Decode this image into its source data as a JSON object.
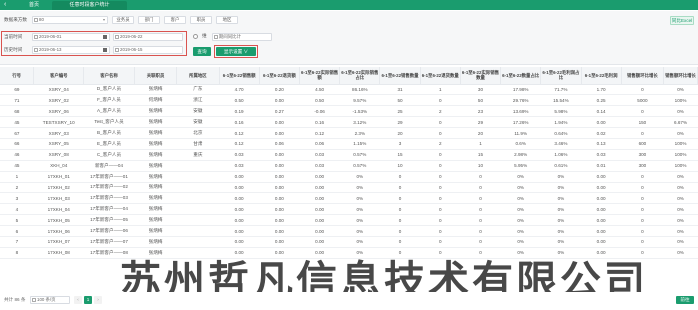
{
  "topbar": {
    "back_icon": "‹",
    "tab_home": "首页",
    "tab_current": "任意时段客户统计"
  },
  "filters": {
    "summary_label": "数据来方数",
    "summary_value": "80",
    "dimension_chips": [
      "业务员",
      "部门",
      "客户",
      "职员",
      "地区"
    ],
    "select_extra_label": "",
    "current_time_label": "当前时间",
    "current_from": "2019-06-01",
    "current_to": "2019-06-22",
    "history_time_label": "历史时间",
    "history_from": "2019-06-13",
    "history_to": "2019-06-15",
    "compare_label": "维",
    "compare_value": "期间同比计",
    "query_button": "查询",
    "display_setting_button": "显示设置 ∨",
    "top_right_button": "同比Excel"
  },
  "table": {
    "headers": [
      "行号",
      "客户编号",
      "客户名称",
      "关联职员",
      "所属地区",
      "6-1至6-22销售额",
      "6-1至6-22退货额",
      "6-1至6-22实际销售额",
      "6-1至6-22实际销售占比",
      "6-1至6-22销售数量",
      "6-1至6-22退货数量",
      "6-1至6-22实际销售数量",
      "6-1至6-22数量占比",
      "6-1至6-22毛利润占比",
      "6-1至6-22毛利润",
      "销售额环比增长",
      "销售额环比增长"
    ],
    "rows": [
      [
        "69",
        "XSRY_04",
        "D_客户人员",
        "张炳梅",
        "广东",
        "4.70",
        "0.20",
        "4.50",
        "86.16%",
        "31",
        "1",
        "30",
        "17.98%",
        "71.7%",
        "1.70",
        "0",
        "0%"
      ],
      [
        "71",
        "XSRY_02",
        "F_客户人员",
        "何炳梅",
        "浙江",
        "0.50",
        "0.00",
        "0.50",
        "9.57%",
        "50",
        "0",
        "50",
        "29.76%",
        "15.54%",
        "0.25",
        "5000",
        "100%"
      ],
      [
        "68",
        "XSRY_06",
        "A_客户人员",
        "张炳梅",
        "安徽",
        "0.19",
        "0.27",
        "-0.06",
        "-1.53%",
        "25",
        "2",
        "23",
        "13.69%",
        "5.98%",
        "0.14",
        "0",
        "0%"
      ],
      [
        "45",
        "TESTXSRY_10",
        "Test_客户人员",
        "张炳梅",
        "安徽",
        "0.16",
        "0.00",
        "0.16",
        "3.12%",
        "29",
        "0",
        "29",
        "17.26%",
        "1.94%",
        "0.00",
        "150",
        "6.67%"
      ],
      [
        "67",
        "XSRY_03",
        "B_客户人员",
        "张炳梅",
        "北京",
        "0.12",
        "0.00",
        "0.12",
        "2.3%",
        "20",
        "0",
        "20",
        "11.9%",
        "0.64%",
        "0.02",
        "0",
        "0%"
      ],
      [
        "66",
        "XSRY_05",
        "E_客户人员",
        "张炳梅",
        "甘肃",
        "0.12",
        "0.06",
        "0.06",
        "1.15%",
        "3",
        "2",
        "1",
        "0.6%",
        "3.46%",
        "0.13",
        "600",
        "100%"
      ],
      [
        "46",
        "XSRY_08",
        "C_客户人员",
        "张炳梅",
        "重庆",
        "0.03",
        "0.00",
        "0.03",
        "0.57%",
        "15",
        "0",
        "15",
        "2.98%",
        "1.06%",
        "0.03",
        "300",
        "100%"
      ],
      [
        "45",
        "XKH_04",
        "新客户——04",
        "张炳梅",
        "",
        "0.03",
        "0.00",
        "0.03",
        "0.57%",
        "10",
        "0",
        "10",
        "5.95%",
        "0.61%",
        "0.01",
        "300",
        "100%"
      ],
      [
        "1",
        "17XKH_01",
        "17年新客户——01",
        "张炳梅",
        "",
        "0.00",
        "0.00",
        "0.00",
        "0%",
        "0",
        "0",
        "0",
        "0%",
        "0%",
        "0.00",
        "0",
        "0%"
      ],
      [
        "2",
        "17XKH_02",
        "17年新客户——02",
        "张炳梅",
        "",
        "0.00",
        "0.00",
        "0.00",
        "0%",
        "0",
        "0",
        "0",
        "0%",
        "0%",
        "0.00",
        "0",
        "0%"
      ],
      [
        "3",
        "17XKH_03",
        "17年新客户——03",
        "张炳梅",
        "",
        "0.00",
        "0.00",
        "0.00",
        "0%",
        "0",
        "0",
        "0",
        "0%",
        "0%",
        "0.00",
        "0",
        "0%"
      ],
      [
        "4",
        "17XKH_04",
        "17年新客户——04",
        "张炳梅",
        "",
        "0.00",
        "0.00",
        "0.00",
        "0%",
        "0",
        "0",
        "0",
        "0%",
        "0%",
        "0.00",
        "0",
        "0%"
      ],
      [
        "5",
        "17XKH_05",
        "17年新客户——05",
        "张炳梅",
        "",
        "0.00",
        "0.00",
        "0.00",
        "0%",
        "0",
        "0",
        "0",
        "0%",
        "0%",
        "0.00",
        "0",
        "0%"
      ],
      [
        "6",
        "17XKH_06",
        "17年新客户——06",
        "张炳梅",
        "",
        "0.00",
        "0.00",
        "0.00",
        "0%",
        "0",
        "0",
        "0",
        "0%",
        "0%",
        "0.00",
        "0",
        "0%"
      ],
      [
        "7",
        "17XKH_07",
        "17年新客户——07",
        "张炳梅",
        "",
        "0.00",
        "0.00",
        "0.00",
        "0%",
        "0",
        "0",
        "0",
        "0%",
        "0%",
        "0.00",
        "0",
        "0%"
      ],
      [
        "8",
        "17XKH_08",
        "17年新客户——08",
        "张炳梅",
        "",
        "0.00",
        "0.00",
        "0.00",
        "0%",
        "0",
        "0",
        "0",
        "0%",
        "0%",
        "0.00",
        "0",
        "0%"
      ]
    ]
  },
  "footer": {
    "total_text": "共计 86 条",
    "page_size": "100 条/页",
    "current_page": "1",
    "right_text": "前往"
  },
  "watermark": "苏州哲凡信息技术有限公司",
  "colors": {
    "brand": "#1a9c6e",
    "highlight_border": "#d9534f"
  }
}
